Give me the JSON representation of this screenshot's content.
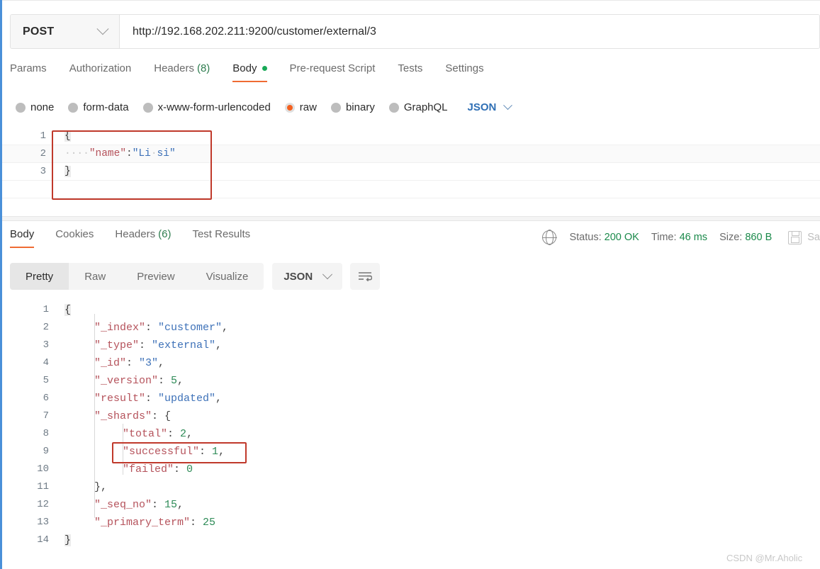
{
  "request": {
    "method": "POST",
    "method_icon": "chevron-down-icon",
    "url": "http://192.168.202.211:9200/customer/external/3",
    "tabs": [
      {
        "label": "Params",
        "active": false
      },
      {
        "label": "Authorization",
        "active": false
      },
      {
        "label": "Headers",
        "count": "(8)",
        "active": false
      },
      {
        "label": "Body",
        "active": true,
        "dot": true
      },
      {
        "label": "Pre-request Script",
        "active": false
      },
      {
        "label": "Tests",
        "active": false
      },
      {
        "label": "Settings",
        "active": false
      }
    ],
    "body_types": [
      {
        "label": "none",
        "selected": false
      },
      {
        "label": "form-data",
        "selected": false
      },
      {
        "label": "x-www-form-urlencoded",
        "selected": false
      },
      {
        "label": "raw",
        "selected": true
      },
      {
        "label": "binary",
        "selected": false
      },
      {
        "label": "GraphQL",
        "selected": false
      }
    ],
    "language": "JSON",
    "editor": {
      "line_numbers": [
        "1",
        "2",
        "3"
      ],
      "lines": [
        {
          "n": "1",
          "open_brace": "{"
        },
        {
          "n": "2",
          "ws": "····",
          "key": "\"name\"",
          "colon": ":",
          "val_open": "\"Li",
          "val_ws": "·",
          "val_close": "si\"",
          "highlight": true
        },
        {
          "n": "3",
          "close_brace": "}"
        }
      ],
      "raw_text": "{\n    \"name\":\"Li si\"\n}"
    }
  },
  "response": {
    "tabs": [
      {
        "label": "Body",
        "active": true
      },
      {
        "label": "Cookies",
        "active": false
      },
      {
        "label": "Headers",
        "count": "(6)",
        "active": false
      },
      {
        "label": "Test Results",
        "active": false
      }
    ],
    "status_icon": "globe-icon",
    "status": {
      "label": "Status:",
      "value": "200 OK"
    },
    "time": {
      "label": "Time:",
      "value": "46 ms"
    },
    "size": {
      "label": "Size:",
      "value": "860 B"
    },
    "save_icon": "save-disk-icon",
    "save_label": "Sa",
    "view_modes": [
      {
        "label": "Pretty",
        "active": true
      },
      {
        "label": "Raw",
        "active": false
      },
      {
        "label": "Preview",
        "active": false
      },
      {
        "label": "Visualize",
        "active": false
      }
    ],
    "format": "JSON",
    "format_icon": "chevron-down-icon",
    "wrap_icon": "word-wrap-icon",
    "body": {
      "line_numbers": [
        "1",
        "2",
        "3",
        "4",
        "5",
        "6",
        "7",
        "8",
        "9",
        "10",
        "11",
        "12",
        "13",
        "14"
      ],
      "lines": [
        {
          "n": "1",
          "indent": 0,
          "brace": "{"
        },
        {
          "n": "2",
          "indent": 1,
          "key": "\"_index\"",
          "sep": ": ",
          "value": "\"customer\"",
          "vtype": "str",
          "comma": ","
        },
        {
          "n": "3",
          "indent": 1,
          "key": "\"_type\"",
          "sep": ": ",
          "value": "\"external\"",
          "vtype": "str",
          "comma": ","
        },
        {
          "n": "4",
          "indent": 1,
          "key": "\"_id\"",
          "sep": ": ",
          "value": "\"3\"",
          "vtype": "str",
          "comma": ","
        },
        {
          "n": "5",
          "indent": 1,
          "key": "\"_version\"",
          "sep": ": ",
          "value": "5",
          "vtype": "num",
          "comma": ","
        },
        {
          "n": "6",
          "indent": 1,
          "key": "\"result\"",
          "sep": ": ",
          "value": "\"updated\"",
          "vtype": "str",
          "comma": ","
        },
        {
          "n": "7",
          "indent": 1,
          "key": "\"_shards\"",
          "sep": ": ",
          "value": "{",
          "vtype": "punc",
          "comma": ""
        },
        {
          "n": "8",
          "indent": 2,
          "key": "\"total\"",
          "sep": ": ",
          "value": "2",
          "vtype": "num",
          "comma": ","
        },
        {
          "n": "9",
          "indent": 2,
          "key": "\"successful\"",
          "sep": ": ",
          "value": "1",
          "vtype": "num",
          "comma": ","
        },
        {
          "n": "10",
          "indent": 2,
          "key": "\"failed\"",
          "sep": ": ",
          "value": "0",
          "vtype": "num",
          "comma": ""
        },
        {
          "n": "11",
          "indent": 1,
          "key": "",
          "sep": "",
          "value": "}",
          "vtype": "punc",
          "comma": ","
        },
        {
          "n": "12",
          "indent": 1,
          "key": "\"_seq_no\"",
          "sep": ": ",
          "value": "15",
          "vtype": "num",
          "comma": ","
        },
        {
          "n": "13",
          "indent": 1,
          "key": "\"_primary_term\"",
          "sep": ": ",
          "value": "25",
          "vtype": "num",
          "comma": ""
        },
        {
          "n": "14",
          "indent": 0,
          "brace": "}"
        }
      ],
      "parsed": {
        "_index": "customer",
        "_type": "external",
        "_id": "3",
        "_version": 5,
        "result": "updated",
        "_shards": {
          "total": 2,
          "successful": 1,
          "failed": 0
        },
        "_seq_no": 15,
        "_primary_term": 25
      }
    }
  },
  "annotations": [
    {
      "name": "request-body-highlight",
      "color": "#c0392b"
    },
    {
      "name": "successful-field-highlight",
      "color": "#c0392b"
    }
  ],
  "watermark": "CSDN @Mr.Aholic",
  "colors": {
    "accent": "#ef6b33",
    "link": "#2f6fb5",
    "success": "#1b8a4b",
    "annotation": "#c0392b",
    "rail": "#4a90d9"
  }
}
